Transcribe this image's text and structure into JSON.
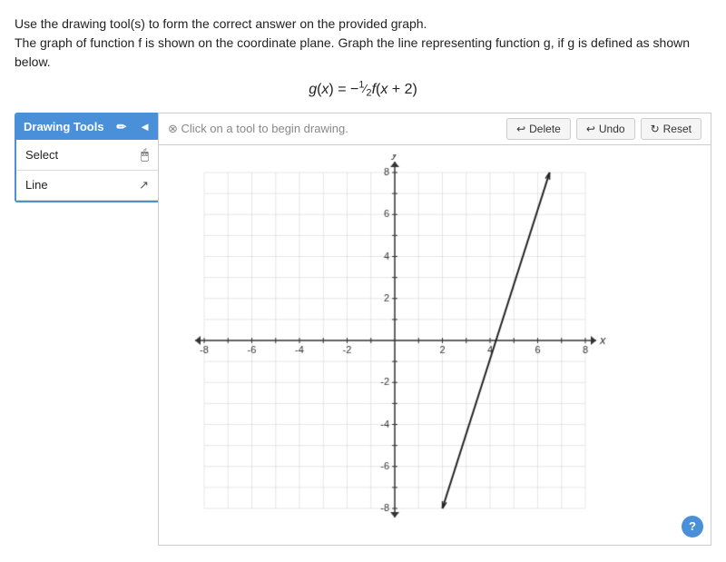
{
  "instructions": {
    "line1": "Use the drawing tool(s) to form the correct answer on the provided graph.",
    "line2": "The graph of function f is shown on the coordinate plane. Graph the line representing function g, if g is defined as shown below."
  },
  "equation": {
    "display": "g(x) = -½f(x + 2)"
  },
  "toolbar": {
    "hint": "Click on a tool to begin drawing.",
    "delete_label": "Delete",
    "undo_label": "Undo",
    "reset_label": "Reset"
  },
  "drawing_tools": {
    "header": "Drawing Tools",
    "items": [
      {
        "label": "Select",
        "icon": "cursor"
      },
      {
        "label": "Line",
        "icon": "line"
      }
    ]
  },
  "help_btn": "?",
  "graph": {
    "x_min": -8,
    "x_max": 8,
    "y_min": -8,
    "y_max": 8,
    "x_label": "x",
    "y_label": "y"
  }
}
